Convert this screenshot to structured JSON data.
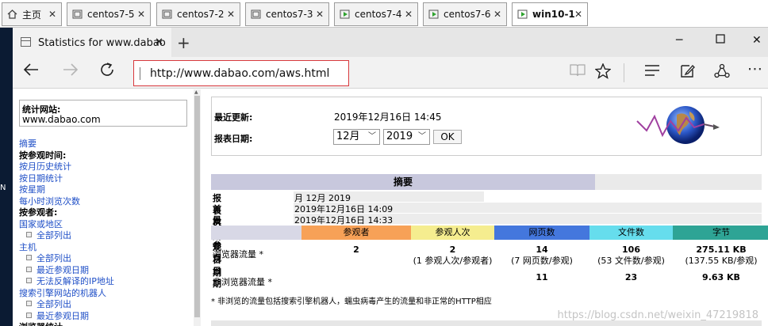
{
  "vm_tabs": [
    {
      "label": "主页",
      "active": false,
      "icon": "home-icon"
    },
    {
      "label": "centos7-5",
      "active": false,
      "icon": "vm-icon"
    },
    {
      "label": "centos7-2",
      "active": false,
      "icon": "vm-icon"
    },
    {
      "label": "centos7-3",
      "active": false,
      "icon": "vm-icon"
    },
    {
      "label": "centos7-4",
      "active": false,
      "icon": "vm-running-icon"
    },
    {
      "label": "centos7-6",
      "active": false,
      "icon": "vm-running-icon"
    },
    {
      "label": "win10-1",
      "active": true,
      "icon": "vm-running-icon"
    }
  ],
  "host": {
    "side_char": "N"
  },
  "browser": {
    "tab_title": "Statistics for www.dabao",
    "close_glyph": "✕",
    "new_tab_glyph": "+",
    "url": "http://www.dabao.com/aws.html"
  },
  "sidebar": {
    "site_label": "统计网站:",
    "site_value": "www.dabao.com",
    "items": [
      {
        "label": "摘要",
        "style": "link"
      },
      {
        "label": "按参观时间:",
        "style": "bold"
      },
      {
        "label": "按月历史统计",
        "style": "link"
      },
      {
        "label": "按日期统计",
        "style": "link"
      },
      {
        "label": "按星期",
        "style": "link"
      },
      {
        "label": "每小时浏览次数",
        "style": "link"
      },
      {
        "label": "按参观者:",
        "style": "bold"
      },
      {
        "label": "国家或地区",
        "style": "link"
      },
      {
        "label": "全部列出",
        "style": "sublink"
      },
      {
        "label": "主机",
        "style": "link"
      },
      {
        "label": "全部列出",
        "style": "sublink"
      },
      {
        "label": "最近参观日期",
        "style": "sublink"
      },
      {
        "label": "无法反解译的IP地址",
        "style": "sublink"
      },
      {
        "label": "搜索引擎网站的机器人",
        "style": "link"
      },
      {
        "label": "全部列出",
        "style": "sublink"
      },
      {
        "label": "最近参观日期",
        "style": "sublink"
      },
      {
        "label": "浏览器统计",
        "style": "bold"
      }
    ]
  },
  "report": {
    "last_update_label": "最近更新:",
    "last_update_value": "2019年12月16日 14:45",
    "report_date_label": "报表日期:",
    "month_select": "12月",
    "year_select": "2019",
    "ok_label": "OK"
  },
  "summary": {
    "title": "摘要",
    "info": [
      {
        "key": "报表日期",
        "value": "月 12月 2019"
      },
      {
        "key": "首次参观日期",
        "value": "2019年12月16日 14:09"
      },
      {
        "key": "最近参观日期",
        "value": "2019年12月16日 14:33"
      }
    ],
    "columns": [
      {
        "label": "参观者",
        "color": "#f7a157"
      },
      {
        "label": "参观人次",
        "color": "#f5ed8f"
      },
      {
        "label": "网页数",
        "color": "#4477dd"
      },
      {
        "label": "文件数",
        "color": "#66dded"
      },
      {
        "label": "字节",
        "color": "#2ea495"
      }
    ],
    "rows": [
      {
        "label": "浏览器流量 *",
        "cells": [
          {
            "main": "2",
            "sub": ""
          },
          {
            "main": "2",
            "sub": "(1 参观人次/参观者)"
          },
          {
            "main": "14",
            "sub": "(7 网页数/参观)"
          },
          {
            "main": "106",
            "sub": "(53 文件数/参观)"
          },
          {
            "main": "275.11 KB",
            "sub": "(137.55 KB/参观)"
          }
        ]
      },
      {
        "label": "非浏览器流量 *",
        "cells": [
          {
            "main": "",
            "sub": ""
          },
          {
            "main": "",
            "sub": ""
          },
          {
            "main": "11",
            "sub": ""
          },
          {
            "main": "23",
            "sub": ""
          },
          {
            "main": "9.63 KB",
            "sub": ""
          }
        ]
      }
    ],
    "footnote": "* 非浏览的流量包括搜索引擎机器人，蠕虫病毒产生的流量和非正常的HTTP相应"
  },
  "watermark": "https://blog.csdn.net/weixin_47219818"
}
